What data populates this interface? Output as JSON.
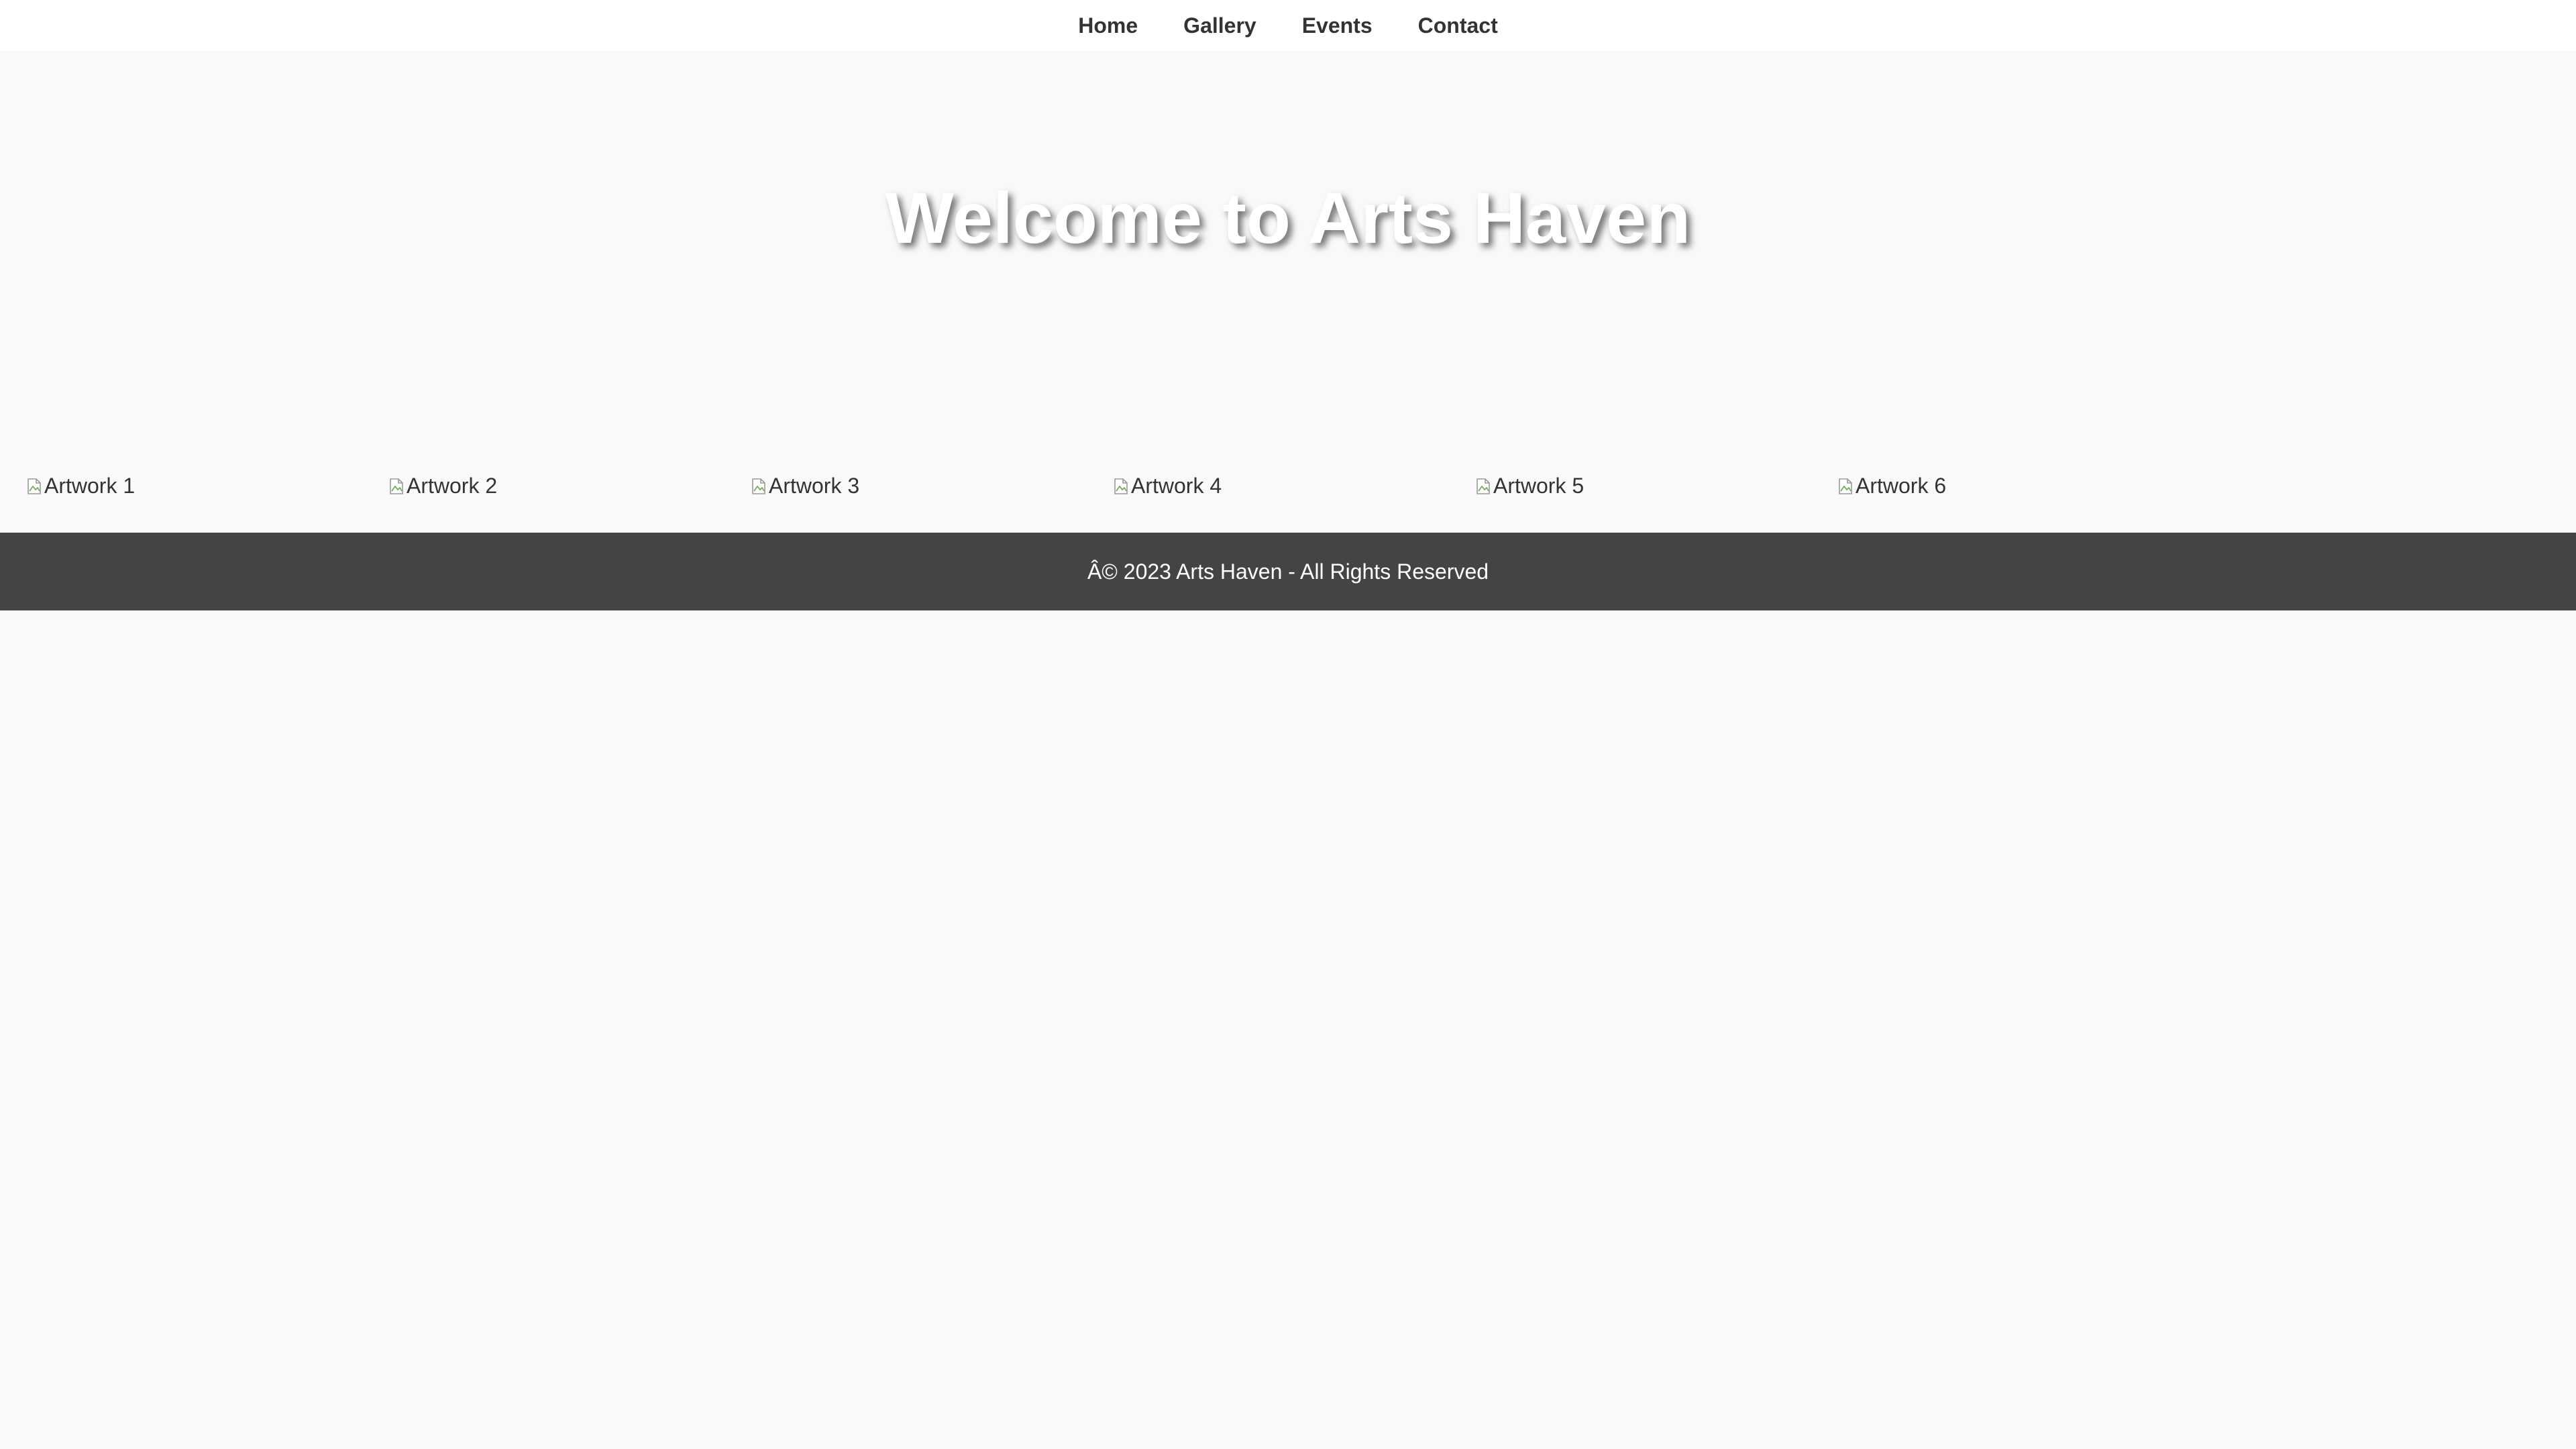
{
  "nav": {
    "items": [
      {
        "label": "Home"
      },
      {
        "label": "Gallery"
      },
      {
        "label": "Events"
      },
      {
        "label": "Contact"
      }
    ]
  },
  "hero": {
    "title": "Welcome to Arts Haven"
  },
  "gallery": {
    "items": [
      {
        "alt": "Artwork 1",
        "icon": "broken-image-icon"
      },
      {
        "alt": "Artwork 2",
        "icon": "broken-image-icon"
      },
      {
        "alt": "Artwork 3",
        "icon": "broken-image-icon"
      },
      {
        "alt": "Artwork 4",
        "icon": "broken-image-icon"
      },
      {
        "alt": "Artwork 5",
        "icon": "broken-image-icon"
      },
      {
        "alt": "Artwork 6",
        "icon": "broken-image-icon"
      }
    ]
  },
  "footer": {
    "text": "Â© 2023 Arts Haven - All Rights Reserved"
  },
  "colors": {
    "page_background": "#f9f9f9",
    "nav_background": "#ffffff",
    "footer_background": "#444444",
    "text": "#333333",
    "hero_title": "#ffffff"
  }
}
